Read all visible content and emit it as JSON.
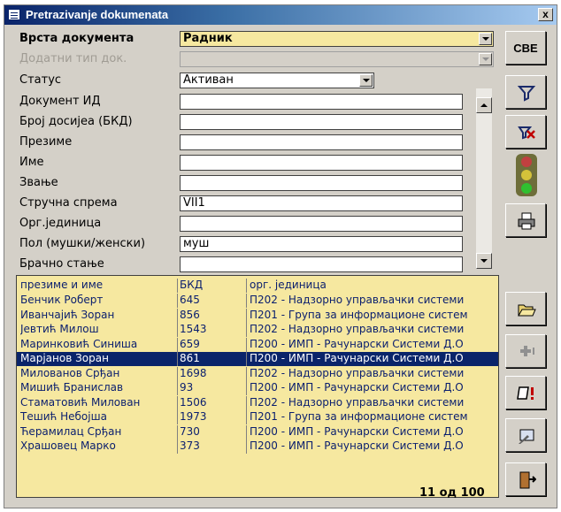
{
  "window": {
    "title": "Pretrazivanje dokumenata",
    "close_label": "x"
  },
  "form": {
    "doc_type": {
      "label": "Врста документа",
      "value": "Радник"
    },
    "extra_type": {
      "label": "Додатни тип док.",
      "value": ""
    },
    "status": {
      "label": "Статус",
      "value": "Активан"
    },
    "doc_id": {
      "label": "Документ ИД",
      "value": ""
    },
    "dossier": {
      "label": "Број досијеа (БКД)",
      "value": ""
    },
    "surname": {
      "label": "Презиме",
      "value": ""
    },
    "name": {
      "label": "Име",
      "value": ""
    },
    "title": {
      "label": "Звање",
      "value": ""
    },
    "qualification": {
      "label": "Стручна спрема",
      "value": "VII1"
    },
    "org_unit": {
      "label": "Орг.јединица",
      "value": ""
    },
    "gender": {
      "label": "Пол (мушки/женски)",
      "value": "муш"
    },
    "marital": {
      "label": "Брачно стање",
      "value": ""
    }
  },
  "list": {
    "columns": [
      "презиме и име",
      "БКД",
      "орг. јединица"
    ],
    "rows": [
      {
        "name": "Бенчик Роберт",
        "bkd": "645",
        "org": "П202 - Надзорно управљачки системи"
      },
      {
        "name": "Иванчајић Зоран",
        "bkd": "856",
        "org": "П201 - Група за информационе систем"
      },
      {
        "name": "Јевтић Милош",
        "bkd": "1543",
        "org": "П202 - Надзорно управљачки системи"
      },
      {
        "name": "Маринковић Синиша",
        "bkd": "659",
        "org": "П200 - ИМП - Рачунарски Системи Д.О"
      },
      {
        "name": "Марјанов Зоран",
        "bkd": "861",
        "org": "П200 - ИМП - Рачунарски Системи Д.О",
        "selected": true
      },
      {
        "name": "Милованов Срђан",
        "bkd": "1698",
        "org": "П202 - Надзорно управљачки системи"
      },
      {
        "name": "Мишић Бранислав",
        "bkd": "93",
        "org": "П200 - ИМП - Рачунарски Системи Д.О"
      },
      {
        "name": "Стаматовић Милован",
        "bkd": "1506",
        "org": "П202 - Надзорно управљачки системи"
      },
      {
        "name": "Тешић Небојша",
        "bkd": "1973",
        "org": "П201 - Група за информационе систем"
      },
      {
        "name": "Ћерамилац Срђан",
        "bkd": "730",
        "org": "П200 - ИМП - Рачунарски Системи Д.О"
      },
      {
        "name": "Храшовец Марко",
        "bkd": "373",
        "org": "П200 - ИМП - Рачунарски Системи Д.О"
      }
    ],
    "count_text": "11 од 100"
  },
  "toolbar": {
    "all_label": "СВЕ",
    "icons": [
      "filter-icon",
      "clear-filter-icon",
      "traffic-light-icon",
      "print-icon",
      "open-folder-icon",
      "add-icon",
      "warning-doc-icon",
      "edit-image-icon",
      "exit-door-icon"
    ]
  },
  "colors": {
    "title_bar": "#0a246a",
    "list_bg": "#f6e8a0",
    "selection": "#0a246a",
    "window_bg": "#d4d0c8"
  }
}
